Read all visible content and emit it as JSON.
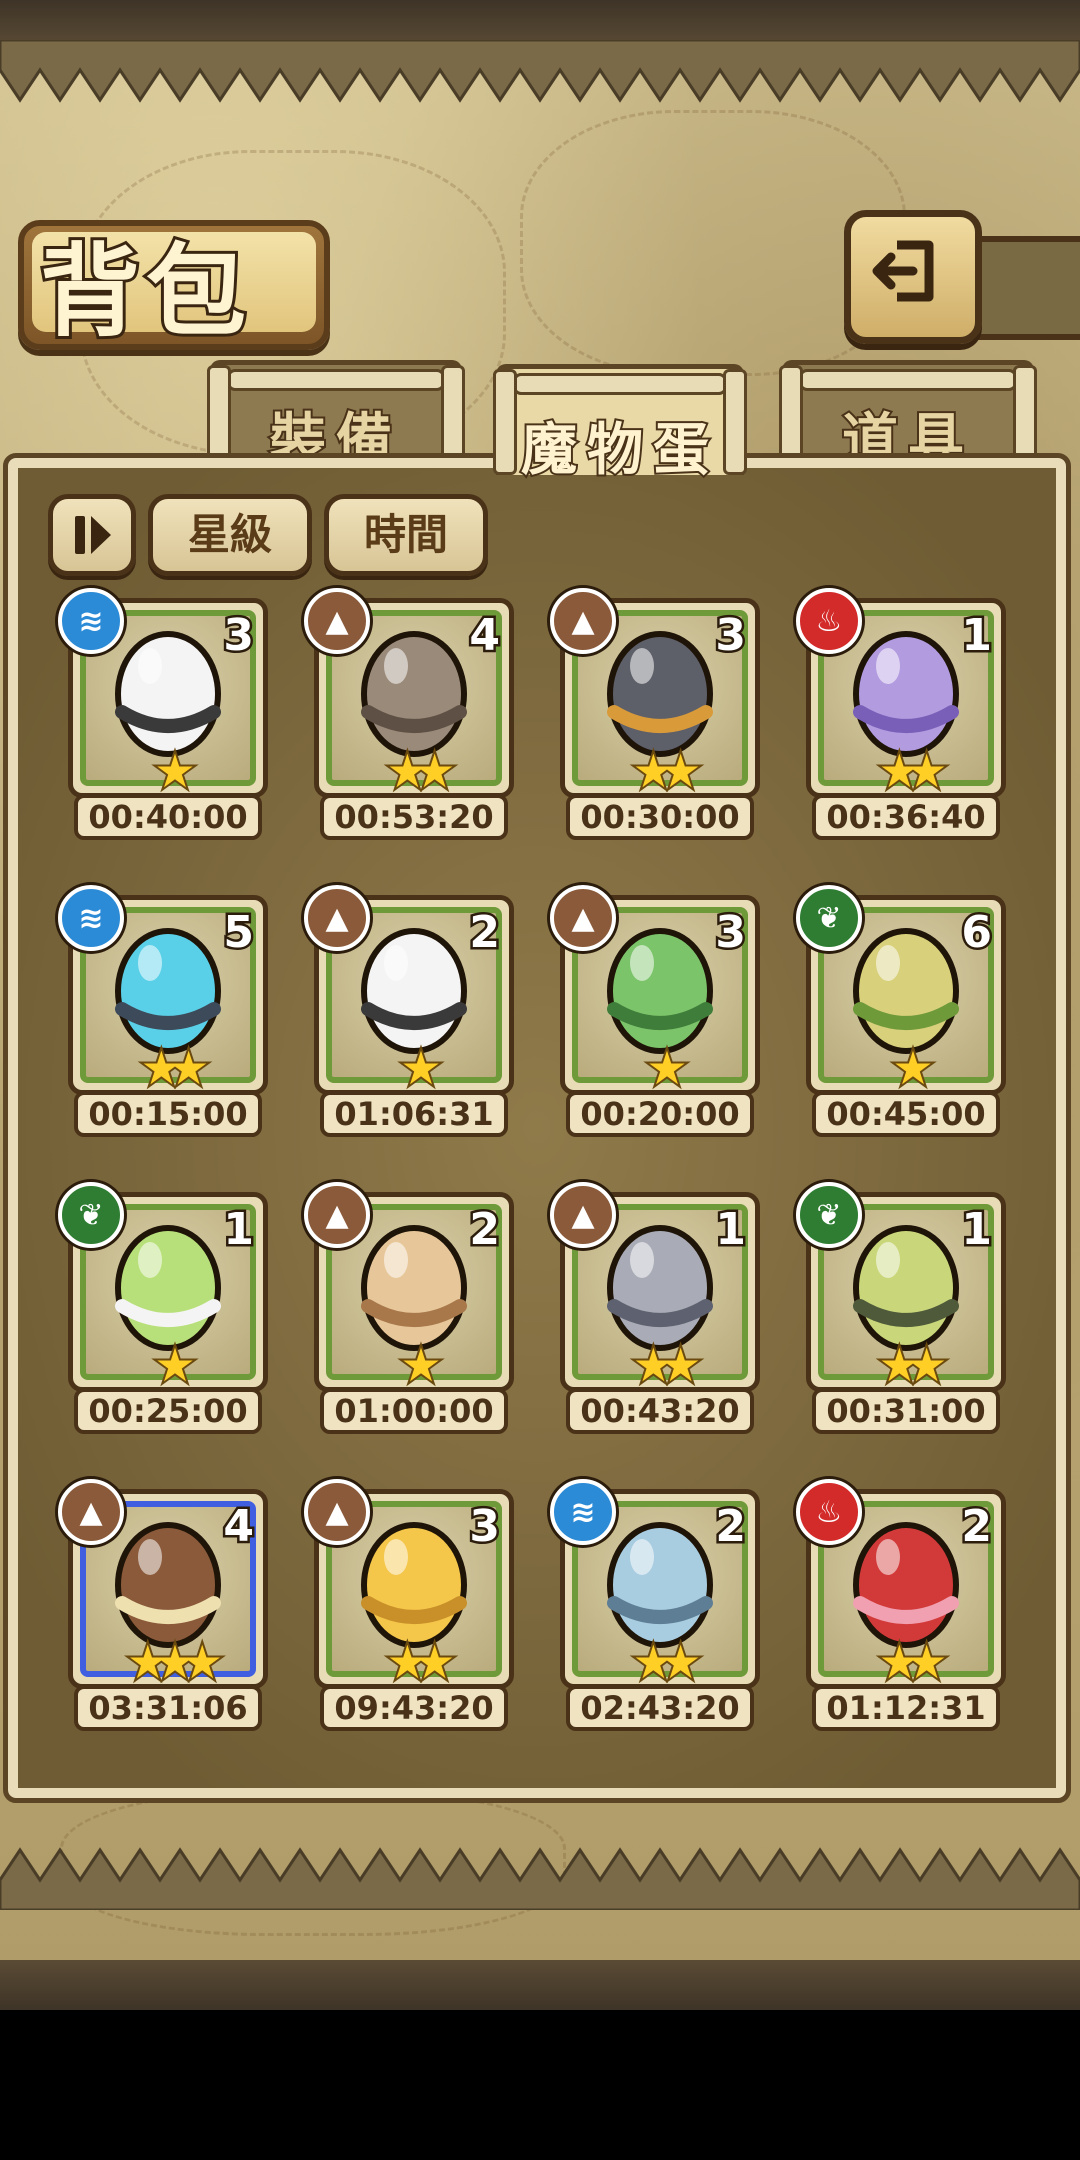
{
  "title": "背包",
  "back_button_label": "",
  "tabs": [
    {
      "label": "裝備",
      "active": false
    },
    {
      "label": "魔物蛋",
      "active": true
    },
    {
      "label": "道具",
      "active": false
    }
  ],
  "filters": {
    "sort_label": "",
    "star_label": "星級",
    "time_label": "時間"
  },
  "eggs": [
    {
      "element": "water",
      "count": "3",
      "stars": 1,
      "time": "00:40:00",
      "icon": "white-striped-egg-icon"
    },
    {
      "element": "earth",
      "count": "4",
      "stars": 2,
      "time": "00:53:20",
      "icon": "rock-egg-icon"
    },
    {
      "element": "earth",
      "count": "3",
      "stars": 2,
      "time": "00:30:00",
      "icon": "dark-shell-egg-icon"
    },
    {
      "element": "fire",
      "count": "1",
      "stars": 2,
      "time": "00:36:40",
      "icon": "purple-flower-egg-icon"
    },
    {
      "element": "water",
      "count": "5",
      "stars": 2,
      "time": "00:15:00",
      "icon": "blue-shell-egg-icon"
    },
    {
      "element": "earth",
      "count": "2",
      "stars": 1,
      "time": "01:06:31",
      "icon": "white-striped-egg-icon"
    },
    {
      "element": "earth",
      "count": "3",
      "stars": 1,
      "time": "00:20:00",
      "icon": "green-bud-egg-icon"
    },
    {
      "element": "leaf",
      "count": "6",
      "stars": 1,
      "time": "00:45:00",
      "icon": "leaf-egg-icon"
    },
    {
      "element": "leaf",
      "count": "1",
      "stars": 1,
      "time": "00:25:00",
      "icon": "bulb-egg-icon"
    },
    {
      "element": "earth",
      "count": "2",
      "stars": 1,
      "time": "01:00:00",
      "icon": "drip-egg-icon"
    },
    {
      "element": "earth",
      "count": "1",
      "stars": 2,
      "time": "00:43:20",
      "icon": "spiral-stone-egg-icon"
    },
    {
      "element": "leaf",
      "count": "1",
      "stars": 2,
      "time": "00:31:00",
      "icon": "green-shell-egg-icon"
    },
    {
      "element": "earth",
      "count": "4",
      "stars": 3,
      "time": "03:31:06",
      "icon": "bear-basket-egg-icon"
    },
    {
      "element": "earth",
      "count": "3",
      "stars": 2,
      "time": "09:43:20",
      "icon": "gold-drip-egg-icon"
    },
    {
      "element": "water",
      "count": "2",
      "stars": 2,
      "time": "02:43:20",
      "icon": "ice-rock-egg-icon"
    },
    {
      "element": "fire",
      "count": "2",
      "stars": 2,
      "time": "01:12:31",
      "icon": "red-swirl-egg-icon"
    }
  ],
  "colors": {
    "frame_green": "#6f9a3a",
    "frame_blue": "#3f5ee0",
    "star": "#ffcf26",
    "water": "#2c8bd6",
    "earth": "#8a5a3a",
    "fire": "#d32a2a",
    "leaf": "#2e7d32"
  }
}
